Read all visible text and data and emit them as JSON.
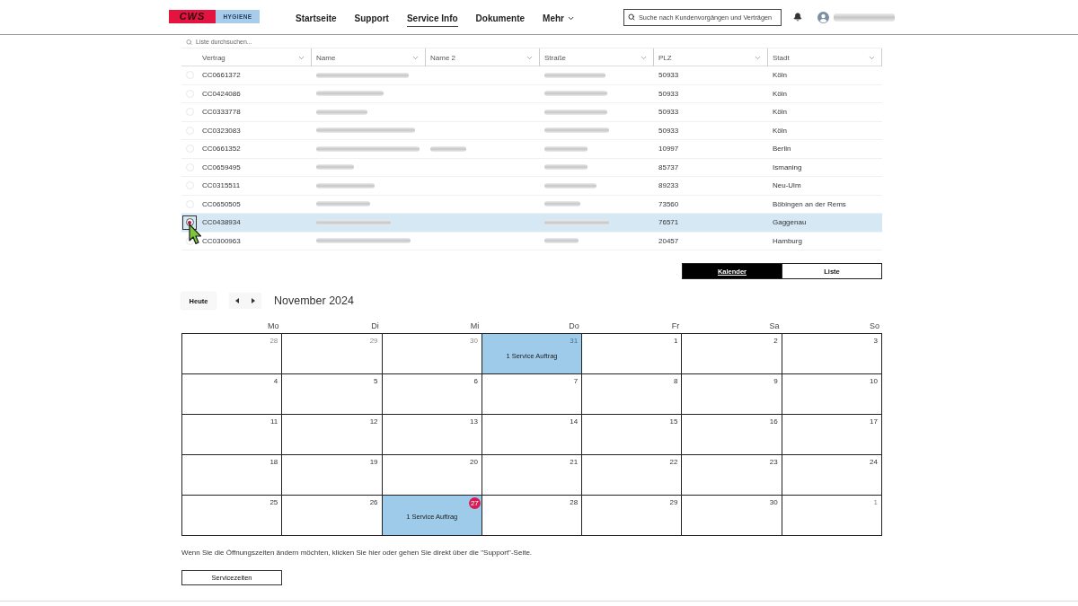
{
  "header": {
    "logo": {
      "wordmark": "CWS",
      "tagline": "HYGIENE"
    },
    "nav": [
      {
        "label": "Startseite",
        "selected": false,
        "dropdown": false
      },
      {
        "label": "Support",
        "selected": false,
        "dropdown": false
      },
      {
        "label": "Service Info",
        "selected": true,
        "dropdown": false
      },
      {
        "label": "Dokumente",
        "selected": false,
        "dropdown": false
      },
      {
        "label": "Mehr",
        "selected": false,
        "dropdown": true
      }
    ],
    "search": {
      "placeholder": "Suche nach Kundenvorgängen und Verträgen"
    }
  },
  "table": {
    "search": {
      "placeholder": "Liste durchsuchen..."
    },
    "columns": [
      {
        "label": "Vertrag"
      },
      {
        "label": "Name"
      },
      {
        "label": "Name 2"
      },
      {
        "label": "Straße"
      },
      {
        "label": "PLZ"
      },
      {
        "label": "Stadt"
      }
    ],
    "rows": [
      {
        "selected": false,
        "cells": [
          {
            "kind": "text",
            "text": "CC0661372"
          },
          {
            "kind": "blurred"
          },
          {
            "kind": "blank"
          },
          {
            "kind": "blurred"
          },
          {
            "kind": "text",
            "text": "50933"
          },
          {
            "kind": "text",
            "text": "Köln"
          }
        ]
      },
      {
        "selected": false,
        "cells": [
          {
            "kind": "text",
            "text": "CC0424086"
          },
          {
            "kind": "blurred"
          },
          {
            "kind": "blank"
          },
          {
            "kind": "blurred"
          },
          {
            "kind": "text",
            "text": "50933"
          },
          {
            "kind": "text",
            "text": "Köln"
          }
        ]
      },
      {
        "selected": false,
        "cells": [
          {
            "kind": "text",
            "text": "CC0333778"
          },
          {
            "kind": "blurred"
          },
          {
            "kind": "blank"
          },
          {
            "kind": "blurred"
          },
          {
            "kind": "text",
            "text": "50933"
          },
          {
            "kind": "text",
            "text": "Köln"
          }
        ]
      },
      {
        "selected": false,
        "cells": [
          {
            "kind": "text",
            "text": "CC0323083"
          },
          {
            "kind": "blurred"
          },
          {
            "kind": "blank"
          },
          {
            "kind": "blurred"
          },
          {
            "kind": "text",
            "text": "50933"
          },
          {
            "kind": "text",
            "text": "Köln"
          }
        ]
      },
      {
        "selected": false,
        "cells": [
          {
            "kind": "text",
            "text": "CC0661352"
          },
          {
            "kind": "blurred"
          },
          {
            "kind": "blurred"
          },
          {
            "kind": "blurred"
          },
          {
            "kind": "text",
            "text": "10997"
          },
          {
            "kind": "text",
            "text": "Berlin"
          }
        ]
      },
      {
        "selected": false,
        "cells": [
          {
            "kind": "text",
            "text": "CC0659495"
          },
          {
            "kind": "blurred"
          },
          {
            "kind": "blank"
          },
          {
            "kind": "blurred"
          },
          {
            "kind": "text",
            "text": "85737"
          },
          {
            "kind": "text",
            "text": "Ismaning"
          }
        ]
      },
      {
        "selected": false,
        "cells": [
          {
            "kind": "text",
            "text": "CC0315511"
          },
          {
            "kind": "blurred"
          },
          {
            "kind": "blank"
          },
          {
            "kind": "blurred"
          },
          {
            "kind": "text",
            "text": "89233"
          },
          {
            "kind": "text",
            "text": "Neu-Ulm"
          }
        ]
      },
      {
        "selected": false,
        "cells": [
          {
            "kind": "text",
            "text": "CC0650505"
          },
          {
            "kind": "blurred"
          },
          {
            "kind": "blank"
          },
          {
            "kind": "blurred"
          },
          {
            "kind": "text",
            "text": "73560"
          },
          {
            "kind": "text",
            "text": "Böbingen an der Rems"
          }
        ]
      },
      {
        "selected": true,
        "cells": [
          {
            "kind": "text",
            "text": "CC0438934"
          },
          {
            "kind": "blurred"
          },
          {
            "kind": "blank"
          },
          {
            "kind": "blurred"
          },
          {
            "kind": "text",
            "text": "76571"
          },
          {
            "kind": "text",
            "text": "Gaggenau"
          }
        ]
      },
      {
        "selected": false,
        "cells": [
          {
            "kind": "text",
            "text": "CC0300963"
          },
          {
            "kind": "blurred"
          },
          {
            "kind": "blank"
          },
          {
            "kind": "blurred"
          },
          {
            "kind": "text",
            "text": "20457"
          },
          {
            "kind": "text",
            "text": "Hamburg"
          }
        ]
      }
    ]
  },
  "view_toggle": [
    {
      "label": "Kalender",
      "selected": true
    },
    {
      "label": "Liste",
      "selected": false
    }
  ],
  "calendar": {
    "today_button": "Heute",
    "month": "November 2024",
    "weekdays": [
      "Mo",
      "Di",
      "Mi",
      "Do",
      "Fr",
      "Sa",
      "So"
    ],
    "weeks": [
      {
        "days": [
          {
            "number": "28",
            "in_month": false,
            "today": false
          },
          {
            "number": "29",
            "in_month": false,
            "today": false
          },
          {
            "number": "30",
            "in_month": false,
            "today": false
          },
          {
            "number": "31",
            "in_month": false,
            "today": false,
            "event": "1 Service Auftrag"
          },
          {
            "number": "1",
            "in_month": true,
            "today": false
          },
          {
            "number": "2",
            "in_month": true,
            "today": false
          },
          {
            "number": "3",
            "in_month": true,
            "today": false
          }
        ]
      },
      {
        "days": [
          {
            "number": "4",
            "in_month": true,
            "today": false
          },
          {
            "number": "5",
            "in_month": true,
            "today": false
          },
          {
            "number": "6",
            "in_month": true,
            "today": false
          },
          {
            "number": "7",
            "in_month": true,
            "today": false
          },
          {
            "number": "8",
            "in_month": true,
            "today": false
          },
          {
            "number": "9",
            "in_month": true,
            "today": false
          },
          {
            "number": "10",
            "in_month": true,
            "today": false
          }
        ]
      },
      {
        "days": [
          {
            "number": "11",
            "in_month": true,
            "today": false
          },
          {
            "number": "12",
            "in_month": true,
            "today": false
          },
          {
            "number": "13",
            "in_month": true,
            "today": false
          },
          {
            "number": "14",
            "in_month": true,
            "today": false
          },
          {
            "number": "15",
            "in_month": true,
            "today": false
          },
          {
            "number": "16",
            "in_month": true,
            "today": false
          },
          {
            "number": "17",
            "in_month": true,
            "today": false
          }
        ]
      },
      {
        "days": [
          {
            "number": "18",
            "in_month": true,
            "today": false
          },
          {
            "number": "19",
            "in_month": true,
            "today": false
          },
          {
            "number": "20",
            "in_month": true,
            "today": false
          },
          {
            "number": "21",
            "in_month": true,
            "today": false
          },
          {
            "number": "22",
            "in_month": true,
            "today": false
          },
          {
            "number": "23",
            "in_month": true,
            "today": false
          },
          {
            "number": "24",
            "in_month": true,
            "today": false
          }
        ]
      },
      {
        "days": [
          {
            "number": "25",
            "in_month": true,
            "today": false
          },
          {
            "number": "26",
            "in_month": true,
            "today": false
          },
          {
            "number": "27",
            "in_month": true,
            "today": true,
            "event": "1 Service Auftrag"
          },
          {
            "number": "28",
            "in_month": true,
            "today": false
          },
          {
            "number": "29",
            "in_month": true,
            "today": false
          },
          {
            "number": "30",
            "in_month": true,
            "today": false
          },
          {
            "number": "1",
            "in_month": false,
            "today": false
          }
        ]
      }
    ]
  },
  "note": "Wenn Sie die Öffnungszeiten ändern möchten, klicken Sie hier oder gehen Sie direkt über die \"Support\"-Seite.",
  "service_button": "Servicezeiten"
}
